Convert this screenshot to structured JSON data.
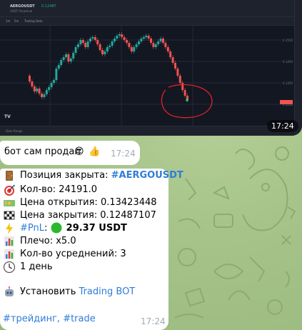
{
  "screenshot": {
    "symbol": "AERGOUSDT",
    "symbol_sub": "USDT Perpetual",
    "price": "0.12487",
    "toolbar_items": [
      "1m",
      "5m",
      "Trading Data"
    ],
    "bottom_left": "Date Range",
    "bottom_right": "",
    "logo": "TV",
    "time": "17:24",
    "annotation_color": "#e0202a"
  },
  "message1": {
    "text": "бот сам продал",
    "emojis": [
      "😍",
      "👍"
    ],
    "time": "17:24"
  },
  "message2": {
    "position_closed_label": "Позиция закрыта: ",
    "position_symbol": "#AERGOUSDT",
    "qty": "Кол-во: 24191.0",
    "open_price": "Цена открытия: 0.13423448",
    "close_price": "Цена закрытия: 0.12487107",
    "pnl_tag": "#PnL",
    "pnl_sep": ": ",
    "pnl_value": "29.37 USDT",
    "leverage": "Плечо: x5.0",
    "averaging": "Кол-во усреднений: 3",
    "duration": "1 день",
    "install_label": "Установить ",
    "install_link": "Trading BOT",
    "tags": "#трейдинг, #trade",
    "time": "17:24"
  },
  "colors": {
    "link": "#2f7dd8",
    "pnl_dot": "#2bb82e",
    "bubble": "#ffffff",
    "wallpaper": "#9fbd84"
  }
}
